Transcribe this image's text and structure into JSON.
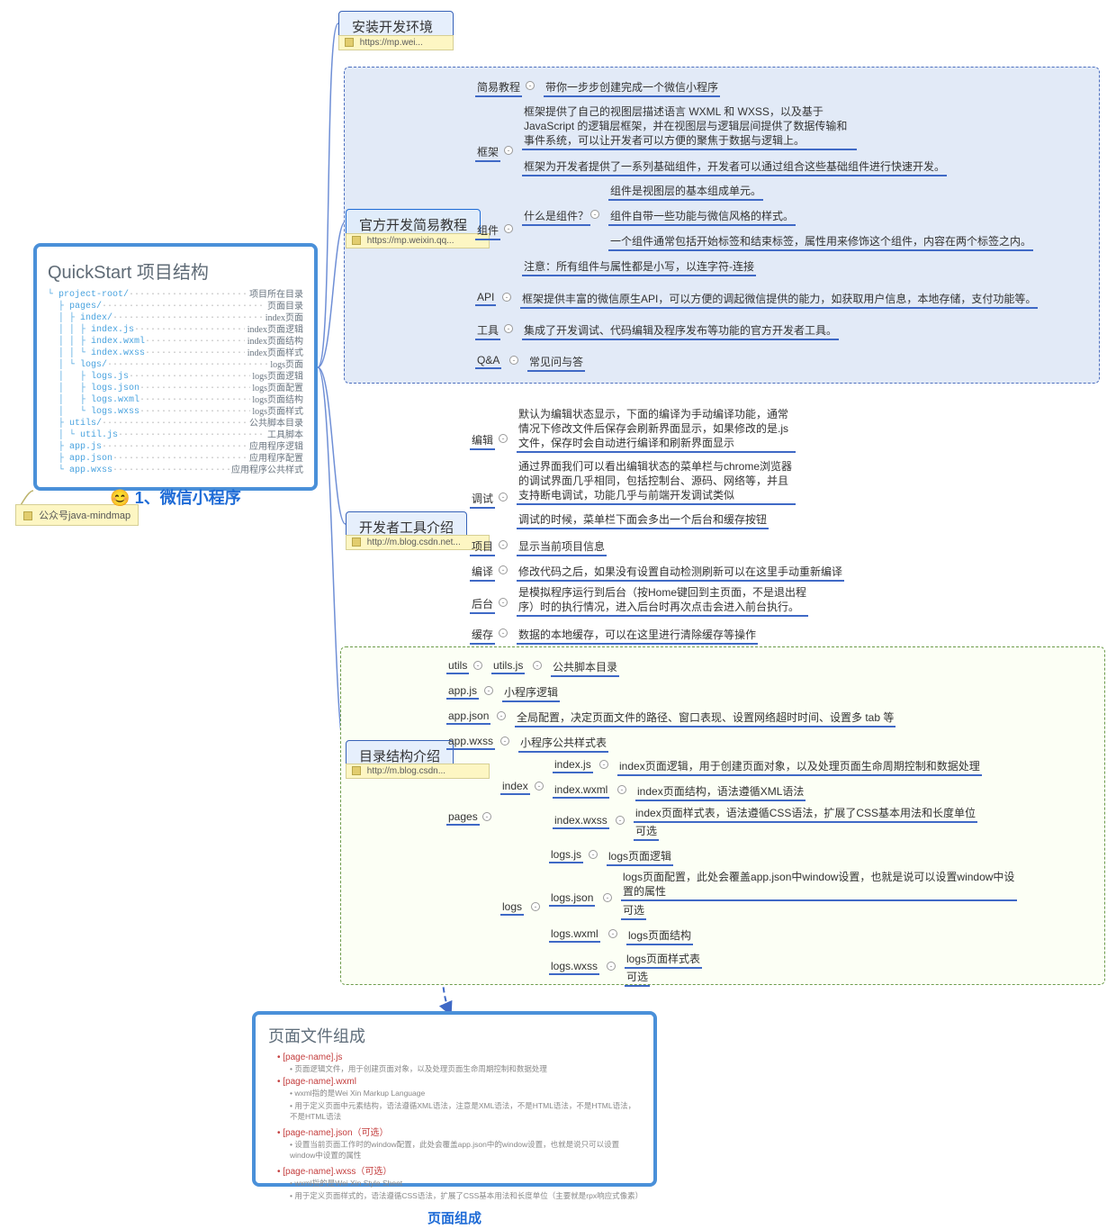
{
  "root_note": "公众号java-mindmap",
  "card1": {
    "title": "QuickStart 项目结构",
    "footer": "1、微信小程序",
    "tree": [
      {
        "l": "└ project-root/",
        "r": "项目所在目录"
      },
      {
        "l": "  ├ pages/",
        "r": "页面目录"
      },
      {
        "l": "  │ ├ index/",
        "r": "index页面"
      },
      {
        "l": "  │ │ ├ index.js",
        "r": "index页面逻辑"
      },
      {
        "l": "  │ │ ├ index.wxml",
        "r": "index页面结构"
      },
      {
        "l": "  │ │ └ index.wxss",
        "r": "index页面样式"
      },
      {
        "l": "  │ └ logs/",
        "r": "logs页面"
      },
      {
        "l": "  │   ├ logs.js",
        "r": "logs页面逻辑"
      },
      {
        "l": "  │   ├ logs.json",
        "r": "logs页面配置"
      },
      {
        "l": "  │   ├ logs.wxml",
        "r": "logs页面结构"
      },
      {
        "l": "  │   └ logs.wxss",
        "r": "logs页面样式"
      },
      {
        "l": "  ├ utils/",
        "r": "公共脚本目录"
      },
      {
        "l": "  │ └ util.js",
        "r": "工具脚本"
      },
      {
        "l": "  ├ app.js",
        "r": "应用程序逻辑"
      },
      {
        "l": "  ├ app.json",
        "r": "应用程序配置"
      },
      {
        "l": "  └ app.wxss",
        "r": "应用程序公共样式"
      }
    ]
  },
  "branch_a": {
    "label": "安装开发环境",
    "link": "https://mp.wei..."
  },
  "branch_b": {
    "label": "官方开发简易教程",
    "link": "https://mp.weixin.qq...",
    "items": {
      "b1": "简易教程",
      "b1v": "带你一步步创建完成一个微信小程序",
      "b2": "框架",
      "b2v1": "框架提供了自己的视图层描述语言 WXML 和 WXSS，以及基于 JavaScript 的逻辑层框架，并在视图层与逻辑层间提供了数据传输和事件系统，可以让开发者可以方便的聚焦于数据与逻辑上。",
      "b2v2": "框架为开发者提供了一系列基础组件，开发者可以通过组合这些基础组件进行快速开发。",
      "b3": "组件",
      "b3q": "什么是组件？",
      "b3v1": "组件是视图层的基本组成单元。",
      "b3v2": "组件自带一些功能与微信风格的样式。",
      "b3v3": "一个组件通常包括开始标签和结束标签，属性用来修饰这个组件，内容在两个标签之内。",
      "b3v4": "注意：所有组件与属性都是小写，以连字符-连接",
      "b4": "API",
      "b4v": "框架提供丰富的微信原生API，可以方便的调起微信提供的能力，如获取用户信息，本地存储，支付功能等。",
      "b5": "工具",
      "b5v": "集成了开发调试、代码编辑及程序发布等功能的官方开发者工具。",
      "b6": "Q&A",
      "b6v": "常见问与答"
    }
  },
  "branch_c": {
    "label": "开发者工具介绍",
    "link": "http://m.blog.csdn.net...",
    "items": {
      "c1": "编辑",
      "c1v": "默认为编辑状态显示，下面的编译为手动编译功能，通常情况下修改文件后保存会刷新界面显示，如果修改的是.js文件，保存时会自动进行编译和刷新界面显示",
      "c2": "调试",
      "c2v1": "通过界面我们可以看出编辑状态的菜单栏与chrome浏览器的调试界面几乎相同，包括控制台、源码、网络等，并且支持断电调试，功能几乎与前端开发调试类似",
      "c2v2": "调试的时候，菜单栏下面会多出一个后台和缓存按钮",
      "c3": "项目",
      "c3v": "显示当前项目信息",
      "c4": "编译",
      "c4v": "修改代码之后，如果没有设置自动检测刷新可以在这里手动重新编译",
      "c5": "后台",
      "c5v": "是模拟程序运行到后台（按Home键回到主页面，不是退出程序）时的执行情况，进入后台时再次点击会进入前台执行。",
      "c6": "缓存",
      "c6v": "数据的本地缓存，可以在这里进行清除缓存等操作"
    }
  },
  "branch_d": {
    "label": "目录结构介绍",
    "link": "http://m.blog.csdn...",
    "items": {
      "d_utils": "utils",
      "d_utilsjs": "utils.js",
      "d_utilsv": "公共脚本目录",
      "d_appjs": "app.js",
      "d_appjsv": "小程序逻辑",
      "d_appjson": "app.json",
      "d_appjsonv": "全局配置，决定页面文件的路径、窗口表现、设置网络超时时间、设置多 tab 等",
      "d_appwxss": "app.wxss",
      "d_appwxssv": "小程序公共样式表",
      "d_pages": "pages",
      "d_index": "index",
      "d_indexjs": "index.js",
      "d_indexjs_v": "index页面逻辑，用于创建页面对象，以及处理页面生命周期控制和数据处理",
      "d_indexwxml": "index.wxml",
      "d_indexwxml_v": "index页面结构，语法遵循XML语法",
      "d_indexwxss": "index.wxss",
      "d_indexwxss_v": "index页面样式表，语法遵循CSS语法，扩展了CSS基本用法和长度单位",
      "d_indexwxss_opt": "可选",
      "d_logs": "logs",
      "d_logsjs": "logs.js",
      "d_logsjs_v": "logs页面逻辑",
      "d_logsjson": "logs.json",
      "d_logsjson_v": "logs页面配置，此处会覆盖app.json中window设置，也就是说可以设置window中设置的属性",
      "d_logsjson_opt": "可选",
      "d_logswxml": "logs.wxml",
      "d_logswxml_v": "logs页面结构",
      "d_logswxss": "logs.wxss",
      "d_logswxss_v": "logs页面样式表",
      "d_logswxss_opt": "可选"
    }
  },
  "card2": {
    "title": "页面文件组成",
    "footer": "页面组成",
    "rows": [
      {
        "t": "[page-name].js",
        "s": "页面逻辑文件，用于创建页面对象，以及处理页面生命周期控制和数据处理"
      },
      {
        "t": "[page-name].wxml",
        "s": "wxml指的是Wei Xin Markup Language"
      },
      {
        "t": "",
        "s": "用于定义页面中元素结构，语法遵循XML语法，注意是XML语法，不是HTML语法，不是HTML语法，不是HTML语法"
      },
      {
        "t": "[page-name].json（可选）",
        "s": "设置当前页面工作时的window配置，此处会覆盖app.json中的window设置，也就是说只可以设置window中设置的属性"
      },
      {
        "t": "[page-name].wxss（可选）",
        "s": "wxml指的是Wei Xin Style Sheet"
      },
      {
        "t": "",
        "s": "用于定义页面样式的，语法遵循CSS语法，扩展了CSS基本用法和长度单位（主要就是rpx响应式像素）"
      }
    ]
  }
}
